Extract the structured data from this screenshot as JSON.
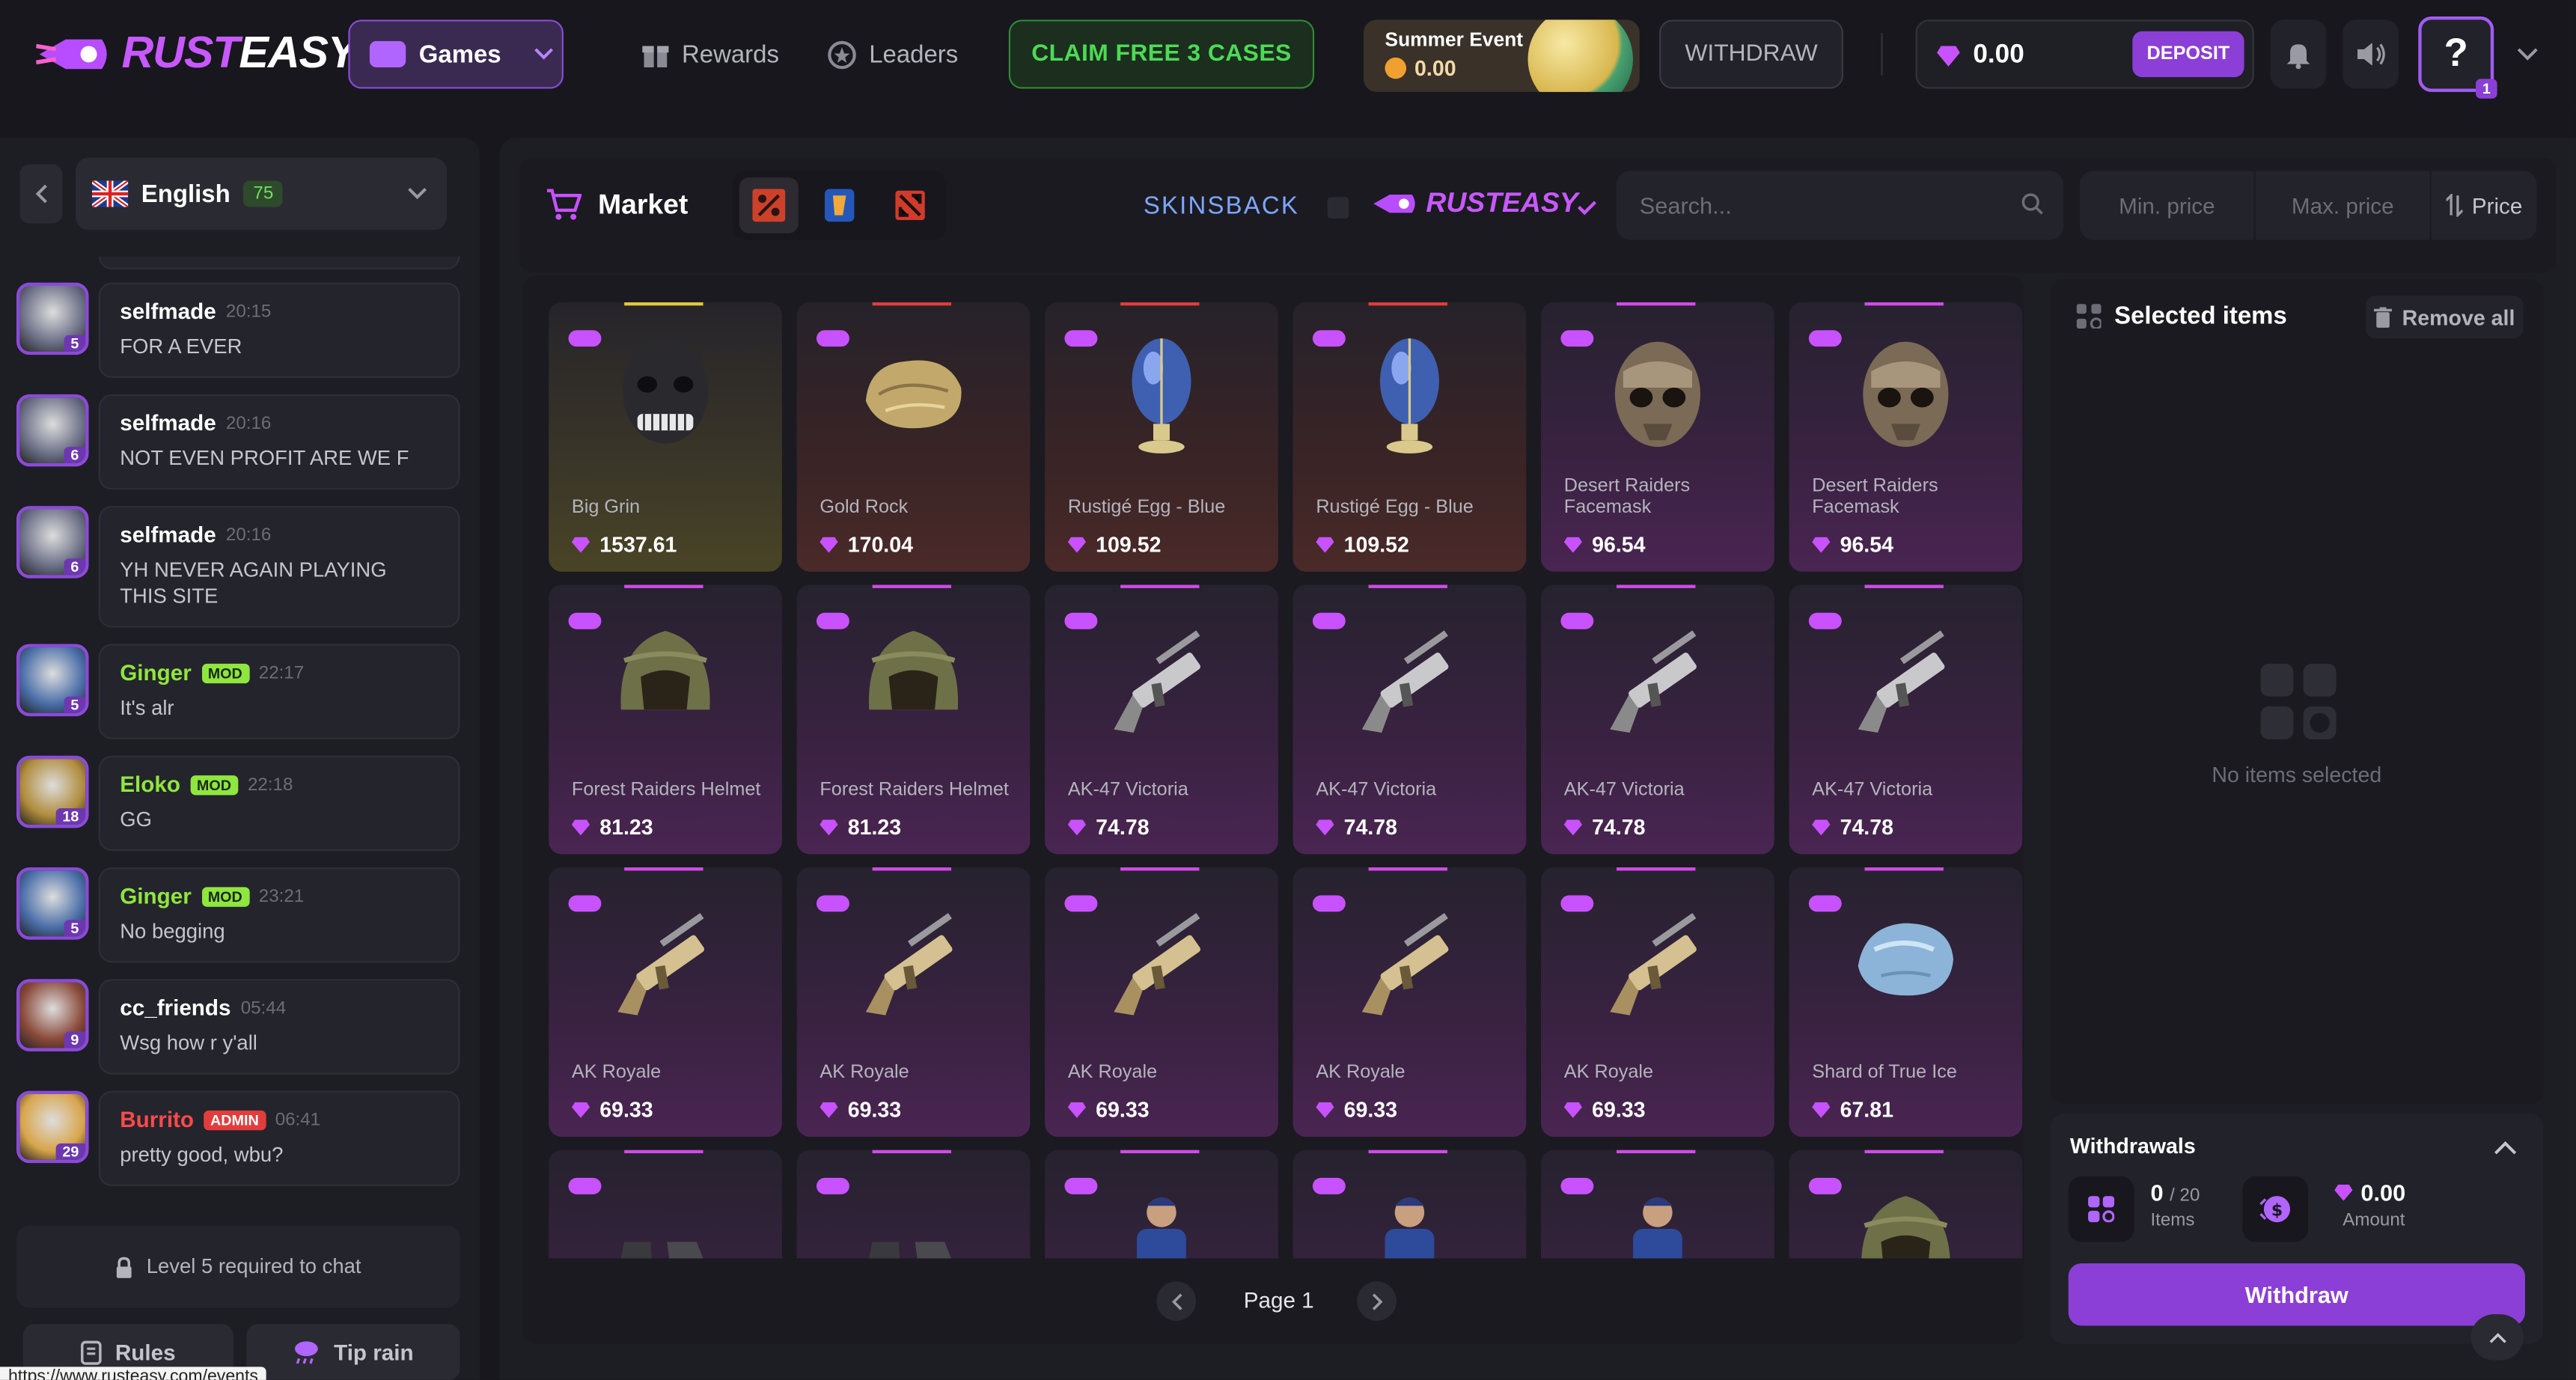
{
  "header": {
    "logo": "RUSTEASY",
    "games_label": "Games",
    "rewards": "Rewards",
    "leaders": "Leaders",
    "claim": "CLAIM FREE 3 CASES",
    "event_title": "Summer Event",
    "event_value": "0.00",
    "withdraw": "WITHDRAW",
    "balance": "0.00",
    "deposit": "DEPOSIT",
    "help_badge": "1"
  },
  "sidebar": {
    "language": "English",
    "online": "75",
    "messages": [
      {
        "user": "selfmade",
        "time": "20:15",
        "text": "FOR A EVER",
        "level": "5",
        "role": "",
        "color": "#ffffff"
      },
      {
        "user": "selfmade",
        "time": "20:16",
        "text": "NOT EVEN PROFIT ARE WE F",
        "level": "6",
        "role": "",
        "color": "#ffffff"
      },
      {
        "user": "selfmade",
        "time": "20:16",
        "text": "YH NEVER AGAIN PLAYING THIS SITE",
        "level": "6",
        "role": "",
        "color": "#ffffff"
      },
      {
        "user": "Ginger",
        "time": "22:17",
        "text": "It's alr",
        "level": "5",
        "role": "MOD",
        "color": "#8fe63f"
      },
      {
        "user": "Eloko",
        "time": "22:18",
        "text": "GG",
        "level": "18",
        "role": "MOD",
        "color": "#8fe63f"
      },
      {
        "user": "Ginger",
        "time": "23:21",
        "text": "No begging",
        "level": "5",
        "role": "MOD",
        "color": "#8fe63f"
      },
      {
        "user": "cc_friends",
        "time": "05:44",
        "text": "Wsg how r y'all",
        "level": "9",
        "role": "",
        "color": "#ffffff"
      },
      {
        "user": "Burrito",
        "time": "06:41",
        "text": "pretty good, wbu?",
        "level": "29",
        "role": "ADMIN",
        "color": "#ff4a4a"
      }
    ],
    "lock_text": "Level 5 required to chat",
    "rules": "Rules",
    "tip_rain": "Tip rain"
  },
  "market": {
    "title": "Market",
    "provider_1": "SKINSBACK",
    "provider_2": "RUSTEASY",
    "search_placeholder": "Search...",
    "min_price": "Min. price",
    "max_price": "Max. price",
    "sort": "Price",
    "page": "Page 1",
    "items": [
      {
        "name": "Big Grin",
        "price": "1537.61",
        "accent": "#e0c93c",
        "art": "mask-dark",
        "bg": "gold"
      },
      {
        "name": "Gold Rock",
        "price": "170.04",
        "accent": "#e03c3c",
        "art": "rock-gold",
        "bg": "red"
      },
      {
        "name": "Rustigé Egg - Blue",
        "price": "109.52",
        "accent": "#e03c3c",
        "art": "egg",
        "bg": "red"
      },
      {
        "name": "Rustigé Egg - Blue",
        "price": "109.52",
        "accent": "#e03c3c",
        "art": "egg",
        "bg": "red"
      },
      {
        "name": "Desert Raiders Facemask",
        "price": "96.54",
        "accent": "#d24ae8",
        "art": "mask-desert",
        "bg": "purple"
      },
      {
        "name": "Desert Raiders Facemask",
        "price": "96.54",
        "accent": "#d24ae8",
        "art": "mask-desert",
        "bg": "purple"
      },
      {
        "name": "Forest Raiders Helmet",
        "price": "81.23",
        "accent": "#d24ae8",
        "art": "helmet",
        "bg": "purple"
      },
      {
        "name": "Forest Raiders Helmet",
        "price": "81.23",
        "accent": "#d24ae8",
        "art": "helmet",
        "bg": "purple"
      },
      {
        "name": "AK-47 Victoria",
        "price": "74.78",
        "accent": "#d24ae8",
        "art": "rifle-silver",
        "bg": "purple"
      },
      {
        "name": "AK-47 Victoria",
        "price": "74.78",
        "accent": "#d24ae8",
        "art": "rifle-silver",
        "bg": "purple"
      },
      {
        "name": "AK-47 Victoria",
        "price": "74.78",
        "accent": "#d24ae8",
        "art": "rifle-silver",
        "bg": "purple"
      },
      {
        "name": "AK-47 Victoria",
        "price": "74.78",
        "accent": "#d24ae8",
        "art": "rifle-silver",
        "bg": "purple"
      },
      {
        "name": "AK Royale",
        "price": "69.33",
        "accent": "#d24ae8",
        "art": "rifle-gold",
        "bg": "purple"
      },
      {
        "name": "AK Royale",
        "price": "69.33",
        "accent": "#d24ae8",
        "art": "rifle-gold",
        "bg": "purple"
      },
      {
        "name": "AK Royale",
        "price": "69.33",
        "accent": "#d24ae8",
        "art": "rifle-gold",
        "bg": "purple"
      },
      {
        "name": "AK Royale",
        "price": "69.33",
        "accent": "#d24ae8",
        "art": "rifle-gold",
        "bg": "purple"
      },
      {
        "name": "AK Royale",
        "price": "69.33",
        "accent": "#d24ae8",
        "art": "rifle-gold",
        "bg": "purple"
      },
      {
        "name": "Shard of True Ice",
        "price": "67.81",
        "accent": "#d24ae8",
        "art": "ice",
        "bg": "purple"
      },
      {
        "name": "",
        "price": "",
        "accent": "#d24ae8",
        "art": "boots",
        "bg": "purple"
      },
      {
        "name": "",
        "price": "",
        "accent": "#d24ae8",
        "art": "boots",
        "bg": "purple"
      },
      {
        "name": "",
        "price": "",
        "accent": "#d24ae8",
        "art": "person",
        "bg": "purple"
      },
      {
        "name": "",
        "price": "",
        "accent": "#d24ae8",
        "art": "person",
        "bg": "purple"
      },
      {
        "name": "",
        "price": "",
        "accent": "#d24ae8",
        "art": "person",
        "bg": "purple"
      },
      {
        "name": "",
        "price": "",
        "accent": "#d24ae8",
        "art": "helmet",
        "bg": "purple"
      }
    ]
  },
  "selected": {
    "title": "Selected items",
    "remove_all": "Remove all",
    "empty": "No items selected"
  },
  "withdrawals": {
    "title": "Withdrawals",
    "count": "0",
    "limit": "/ 20",
    "items_label": "Items",
    "amount": "0.00",
    "amount_label": "Amount",
    "button": "Withdraw"
  },
  "status_url": "https://www.rusteasy.com/events",
  "colors": {
    "accent": "#8b3fd6",
    "claim_green": "#4bdb55",
    "gem": "#c852ff"
  }
}
